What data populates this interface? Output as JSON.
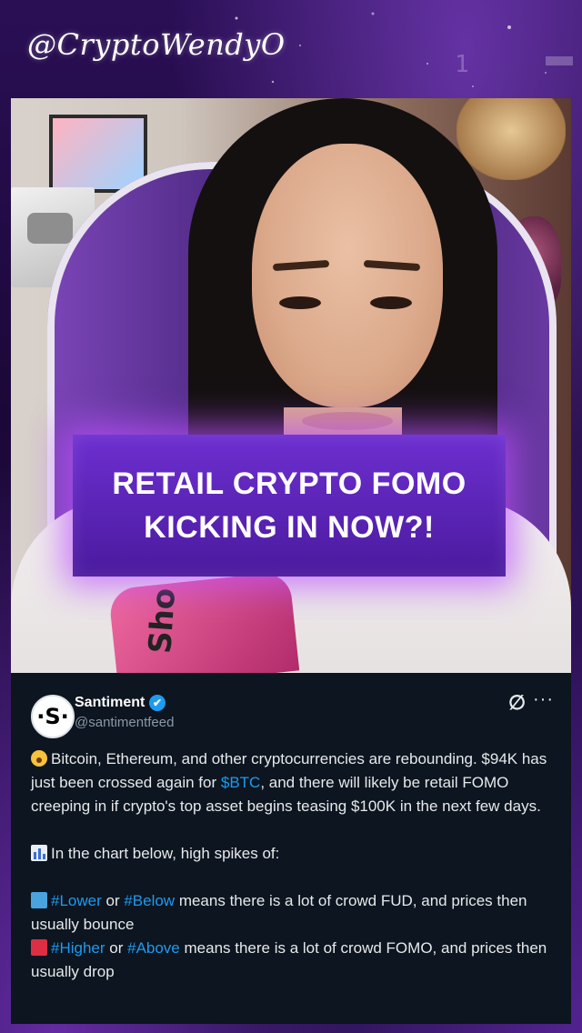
{
  "header": {
    "handle": "@CryptoWendyO",
    "counter": "1"
  },
  "headline": {
    "text": "RETAIL CRYPTO FOMO\nKICKING IN NOW?!"
  },
  "video": {
    "mic_text": "Sho"
  },
  "tweet": {
    "avatar_text": "·S·",
    "author_name": "Santiment",
    "author_handle": "@santimentfeed",
    "verified_mark": "✔",
    "para1": {
      "part1": "Bitcoin, Ethereum, and other cryptocurrencies are rebounding. $94K has just been crossed again for ",
      "link": "$BTC",
      "part2": ", and there will likely be retail FOMO creeping in if crypto's top asset begins teasing $100K in the next few days."
    },
    "para2": "In the chart below, high spikes of:",
    "line_lower": {
      "tag1": "#Lower",
      "mid": " or ",
      "tag2": "#Below",
      "rest": " means there is a lot of crowd FUD, and prices then usually bounce"
    },
    "line_higher": {
      "tag1": "#Higher",
      "mid": " or ",
      "tag2": "#Above",
      "rest": " means there is a lot of crowd FOMO, and prices then usually drop"
    }
  },
  "icons": {
    "x_icon": "x-logo-icon",
    "more_icon": "more-options-icon"
  },
  "colors": {
    "accent_purple": "#6d2fd0",
    "link_blue": "#1d9bf0",
    "tweet_bg": "#0c1520"
  }
}
